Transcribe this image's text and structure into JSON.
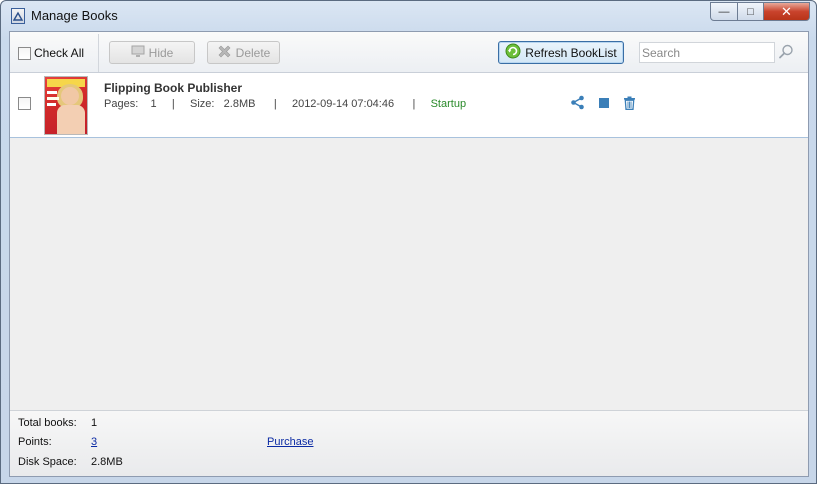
{
  "window": {
    "title": "Manage Books",
    "controls": {
      "minimize": "—",
      "maximize": "□",
      "close": "✕"
    }
  },
  "toolbar": {
    "check_all_label": "Check All",
    "hide_label": "Hide",
    "delete_label": "Delete",
    "refresh_label": "Refresh BookList",
    "search_placeholder": "Search"
  },
  "books": [
    {
      "title": "Flipping Book Publisher",
      "pages_label": "Pages:",
      "pages": "1",
      "size_label": "Size:",
      "size": "2.8MB",
      "date": "2012-09-14 07:04:46",
      "status": "Startup",
      "separator": "|"
    }
  ],
  "footer": {
    "total_books_label": "Total books:",
    "total_books": "1",
    "points_label": "Points:",
    "points": "3",
    "purchase_label": "Purchase",
    "disk_space_label": "Disk Space:",
    "disk_space": "2.8MB"
  },
  "colors": {
    "status_green": "#2a8a2a",
    "action_blue": "#3b7fb8",
    "link_blue": "#0b2aa4",
    "close_red": "#c9432c"
  },
  "icons": {
    "app": "document-icon",
    "hide": "monitor-icon",
    "delete": "x-icon",
    "refresh": "refresh-icon",
    "search": "magnifier-icon",
    "share": "share-icon",
    "stop": "stop-square-icon",
    "trash": "trash-icon"
  }
}
